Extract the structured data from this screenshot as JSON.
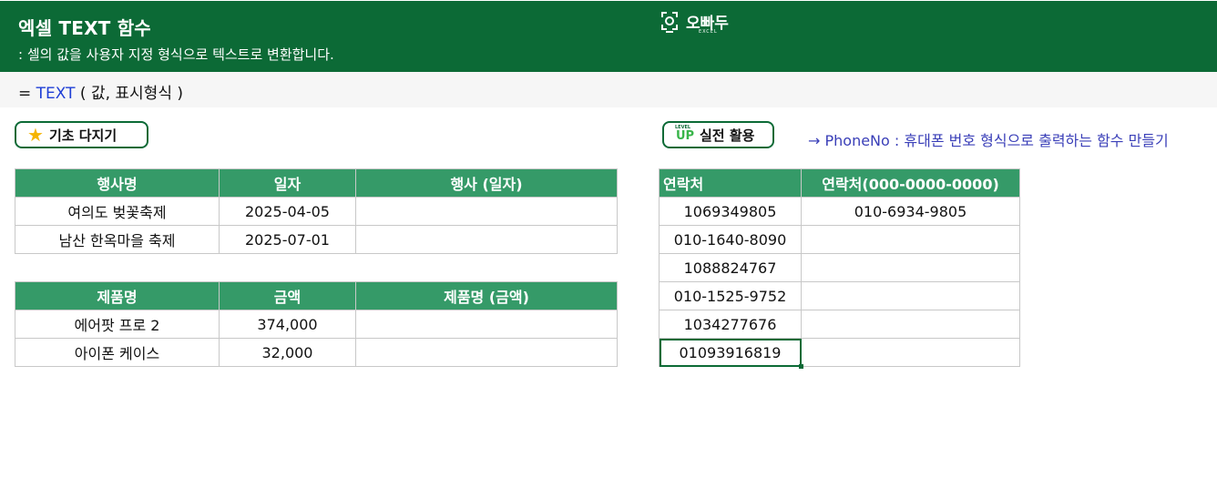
{
  "header": {
    "title": "엑셀 TEXT 함수",
    "subtitle": ": 셀의 값을 사용자 지정 형식으로 텍스트로 변환합니다.",
    "logo_text": "오빠두",
    "logo_sub": "EXCEL",
    "logo_icon": "camera-frame-icon"
  },
  "formula": {
    "prefix": "=",
    "function": "TEXT",
    "args": "( 값, 표시형식 )"
  },
  "badges": {
    "basic": "기초 다지기",
    "basic_icon": "star-icon",
    "advanced": "실전 활용",
    "advanced_icon": "level-up-icon",
    "level_label": "LEVEL",
    "up_label": "UP"
  },
  "advanced_link": "→ PhoneNo : 휴대폰 번호 형식으로 출력하는 함수 만들기",
  "events_table": {
    "headers": [
      "행사명",
      "일자",
      "행사 (일자)"
    ],
    "rows": [
      [
        "여의도 벚꽃축제",
        "2025-04-05",
        ""
      ],
      [
        "남산 한옥마을 축제",
        "2025-07-01",
        ""
      ]
    ]
  },
  "products_table": {
    "headers": [
      "제품명",
      "금액",
      "제품명 (금액)"
    ],
    "rows": [
      [
        "에어팟 프로 2",
        "374,000",
        ""
      ],
      [
        "아이폰 케이스",
        "32,000",
        ""
      ]
    ]
  },
  "contacts_table": {
    "headers": [
      "연락처",
      "연락처(000-0000-0000)"
    ],
    "rows": [
      [
        "1069349805",
        "010-6934-9805"
      ],
      [
        "010-1640-8090",
        ""
      ],
      [
        "1088824767",
        ""
      ],
      [
        "010-1525-9752",
        ""
      ],
      [
        "1034277676",
        ""
      ],
      [
        "01093916819",
        ""
      ]
    ]
  },
  "colors": {
    "banner": "#0c6a36",
    "table_header": "#359a68",
    "function_text": "#1f3fd6",
    "link_text": "#3a3fb8"
  }
}
